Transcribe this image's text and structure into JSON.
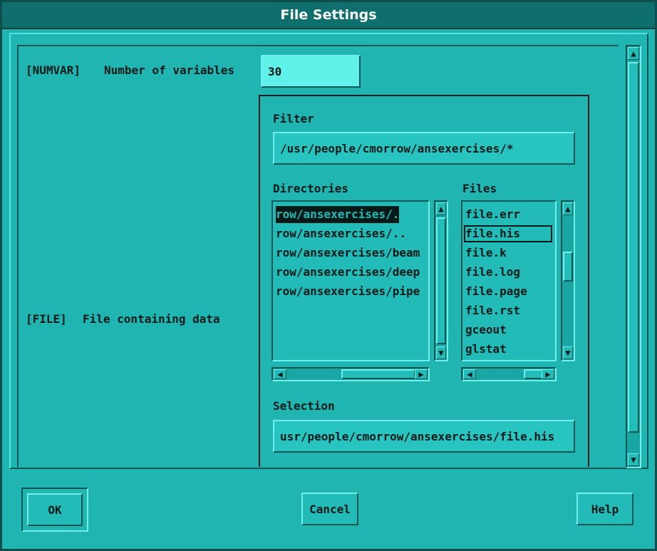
{
  "window": {
    "title": "File Settings"
  },
  "numvar": {
    "tag": "[NUMVAR]",
    "label": "Number of variables",
    "value": "30"
  },
  "file": {
    "tag": "[FILE]",
    "label": "File containing data"
  },
  "selector": {
    "filter_label": "Filter",
    "filter_value": "/usr/people/cmorrow/ansexercises/*",
    "directories_label": "Directories",
    "directories": [
      "row/ansexercises/.",
      "row/ansexercises/..",
      "row/ansexercises/beam",
      "row/ansexercises/deep",
      "row/ansexercises/pipe"
    ],
    "files_label": "Files",
    "files": [
      "file.err",
      "file.his",
      "file.k",
      "file.log",
      "file.page",
      "file.rst",
      "gceout",
      "glstat"
    ],
    "selection_label": "Selection",
    "selection_value": "usr/people/cmorrow/ansexercises/file.his"
  },
  "buttons": {
    "ok": "OK",
    "cancel": "Cancel",
    "help": "Help"
  },
  "colors": {
    "background": "#20b5b1",
    "titlebar": "#0f6f6c",
    "text": "#041a19",
    "highlight_field": "#5ff1ea"
  },
  "icons": {
    "up": "▲",
    "down": "▼",
    "left": "◀",
    "right": "▶"
  }
}
